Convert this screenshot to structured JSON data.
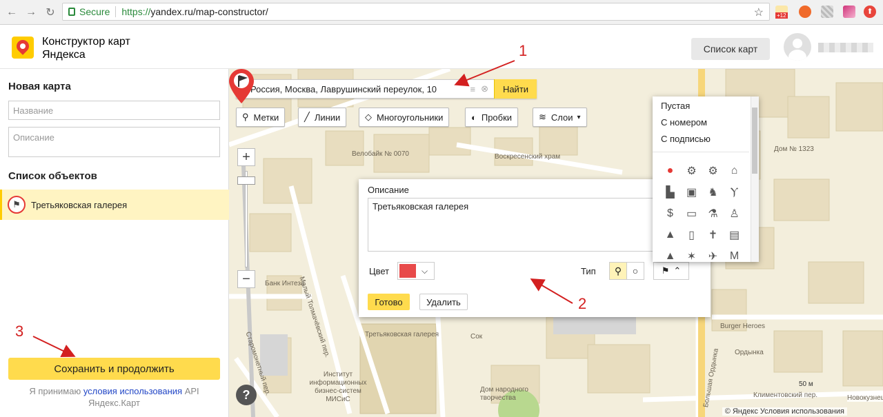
{
  "browser": {
    "secure_label": "Secure",
    "url_prefix": "https://",
    "url_rest": "yandex.ru/map-constructor/",
    "badge": "+12"
  },
  "header": {
    "brand_line1": "Конструктор карт",
    "brand_line2": "Яндекса",
    "list_button": "Список карт"
  },
  "sidebar": {
    "new_map_title": "Новая карта",
    "name_placeholder": "Название",
    "description_placeholder": "Описание",
    "objects_title": "Список объектов",
    "objects": [
      {
        "label": "Третьяковская галерея"
      }
    ],
    "save_button": "Сохранить и продолжить",
    "terms_prefix": "Я принимаю ",
    "terms_link": "условия использования",
    "terms_suffix": " API Яндекс.Карт"
  },
  "map": {
    "search_value": "Россия, Москва, Лаврушинский переулок, 10",
    "search_button": "Найти",
    "tools": {
      "placemarks": "Метки",
      "lines": "Линии",
      "polygons": "Многоугольники",
      "traffic": "Пробки",
      "layers": "Слои"
    },
    "zoom_in": "+",
    "zoom_out": "−",
    "help": "?",
    "copyright": "© Яндекс Условия использования",
    "scale": "50 м",
    "labels": [
      {
        "text": "Велобайк № 0070"
      },
      {
        "text": "Воскресенский храм"
      },
      {
        "text": "Банк Интеза"
      },
      {
        "text": "Третьяковская галерея"
      },
      {
        "text": "Институт информационных бизнес-систем МИСиС"
      },
      {
        "text": "Дом народного творчества"
      },
      {
        "text": "Сок"
      },
      {
        "text": "Burger Heroes"
      },
      {
        "text": "Ордынка"
      },
      {
        "text": "Климентовский пер."
      },
      {
        "text": "Малый Толмачёвский пер."
      },
      {
        "text": "Старомонетный пер."
      },
      {
        "text": "Большая Ордынка"
      },
      {
        "text": "Дом № 1323"
      },
      {
        "text": "Новокузнецкая"
      }
    ]
  },
  "balloon": {
    "title": "Описание",
    "description": "Третьяковская галерея",
    "color_label": "Цвет",
    "color": "#e84a4a",
    "type_label": "Тип",
    "done_button": "Готово",
    "delete_button": "Удалить"
  },
  "icon_dropdown": {
    "options": [
      "Пустая",
      "С номером",
      "С подписью"
    ]
  },
  "annotations": {
    "one": "1",
    "two": "2",
    "three": "3"
  },
  "colors": {
    "accent": "#ffdb4d",
    "marker": "#e53935",
    "annotation": "#d32020"
  }
}
